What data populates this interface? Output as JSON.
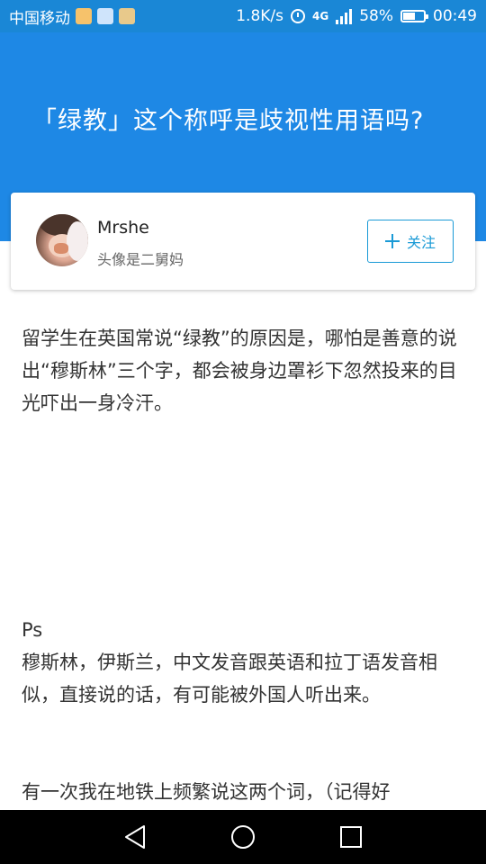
{
  "status_bar": {
    "carrier": "中国移动",
    "speed": "1.8K/s",
    "network": "4G",
    "network_small": "4G",
    "battery": "58%",
    "time": "00:49",
    "notification_icons": [
      "notification-app-icon",
      "notification-bird-icon",
      "notification-lock-icon"
    ],
    "battery_level": 0.58
  },
  "question": {
    "title": "「绿教」这个称呼是歧视性用语吗?"
  },
  "author": {
    "name": "Mrshe",
    "bio": "头像是二舅妈",
    "follow_label": "关注"
  },
  "answer": {
    "paragraphs": [
      "留学生在英国常说“绿教”的原因是，哪怕是善意的说出“穆斯林”三个字，都会被身边罩衫下忽然投来的目光吓出一身冷汗。",
      "Ps",
      "穆斯林，伊斯兰，中文发音跟英语和拉丁语发音相似，直接说的话，有可能被外国人听出来。",
      "有一次我在地铁上频繁说这两个词，（记得好"
    ]
  },
  "nav_bar": {
    "buttons": [
      "back-icon",
      "home-icon",
      "recent-apps-icon"
    ]
  },
  "colors": {
    "header": "#1e88e5",
    "status_bar": "#1a87d6",
    "accent": "#1a9ad6",
    "nav_bar": "#000000"
  }
}
